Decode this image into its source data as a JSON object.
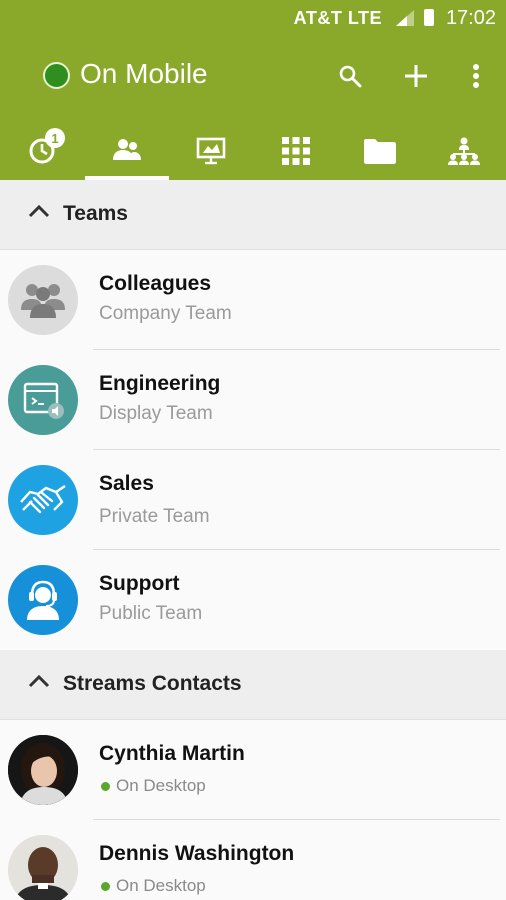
{
  "status_bar": {
    "carrier": "AT&T  LTE",
    "time": "17:02"
  },
  "header": {
    "status_label": "On Mobile",
    "status_color": "#2e8f1f",
    "actions": [
      "search-icon",
      "plus-icon",
      "more-vert-icon"
    ]
  },
  "tabs": [
    {
      "icon": "recent-clock-icon",
      "badge": "1"
    },
    {
      "icon": "contacts-icon",
      "active": true
    },
    {
      "icon": "board-icon"
    },
    {
      "icon": "apps-grid-icon"
    },
    {
      "icon": "folder-icon"
    },
    {
      "icon": "org-chart-icon"
    }
  ],
  "sections": {
    "teams": "Teams",
    "contacts": "Streams Contacts"
  },
  "teams": [
    {
      "name": "Colleagues",
      "type": "Company Team",
      "icon": "group-icon"
    },
    {
      "name": "Engineering",
      "type": "Display Team",
      "icon": "display-window-icon"
    },
    {
      "name": "Sales",
      "type": "Private Team",
      "icon": "handshake-icon"
    },
    {
      "name": "Support",
      "type": "Public Team",
      "icon": "headset-agent-icon"
    }
  ],
  "contacts": [
    {
      "name": "Cynthia Martin",
      "status": "On Desktop"
    },
    {
      "name": "Dennis Washington",
      "status": "On Desktop"
    }
  ],
  "colors": {
    "brand": "#8aa82a",
    "online": "#5aa72a"
  }
}
